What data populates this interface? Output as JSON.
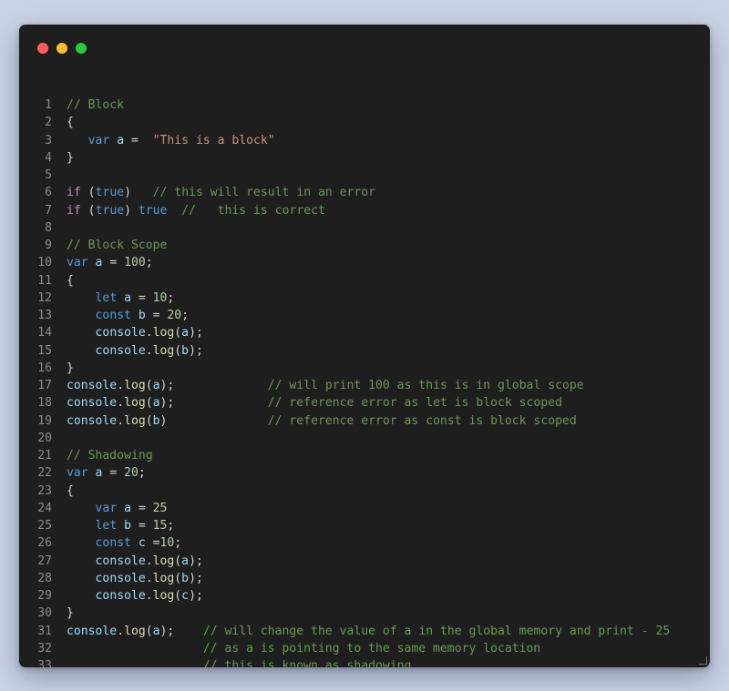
{
  "window": {
    "controls": {
      "close_color": "#ff5f57",
      "minimize_color": "#febc2e",
      "zoom_color": "#28c840"
    }
  },
  "code": {
    "lines": [
      {
        "n": "1",
        "tokens": [
          [
            "c",
            "// Block"
          ]
        ]
      },
      {
        "n": "2",
        "tokens": [
          [
            "p",
            "{"
          ]
        ]
      },
      {
        "n": "3",
        "tokens": [
          [
            "p",
            "   "
          ],
          [
            "k",
            "var"
          ],
          [
            "p",
            " "
          ],
          [
            "v",
            "a"
          ],
          [
            "p",
            " =  "
          ],
          [
            "s",
            "\"This is a block\""
          ]
        ]
      },
      {
        "n": "4",
        "tokens": [
          [
            "p",
            "}"
          ]
        ]
      },
      {
        "n": "5",
        "tokens": []
      },
      {
        "n": "6",
        "tokens": [
          [
            "kc",
            "if"
          ],
          [
            "p",
            " ("
          ],
          [
            "k",
            "true"
          ],
          [
            "p",
            ")   "
          ],
          [
            "c",
            "// this will result in an error"
          ]
        ]
      },
      {
        "n": "7",
        "tokens": [
          [
            "kc",
            "if"
          ],
          [
            "p",
            " ("
          ],
          [
            "k",
            "true"
          ],
          [
            "p",
            ") "
          ],
          [
            "k",
            "true"
          ],
          [
            "p",
            "  "
          ],
          [
            "c",
            "//   this is correct"
          ]
        ]
      },
      {
        "n": "8",
        "tokens": []
      },
      {
        "n": "9",
        "tokens": [
          [
            "c",
            "// Block Scope"
          ]
        ]
      },
      {
        "n": "10",
        "tokens": [
          [
            "k",
            "var"
          ],
          [
            "p",
            " "
          ],
          [
            "v",
            "a"
          ],
          [
            "p",
            " = "
          ],
          [
            "n",
            "100"
          ],
          [
            "p",
            ";"
          ]
        ]
      },
      {
        "n": "11",
        "tokens": [
          [
            "p",
            "{"
          ]
        ]
      },
      {
        "n": "12",
        "tokens": [
          [
            "p",
            "    "
          ],
          [
            "k",
            "let"
          ],
          [
            "p",
            " "
          ],
          [
            "v",
            "a"
          ],
          [
            "p",
            " = "
          ],
          [
            "n",
            "10"
          ],
          [
            "p",
            ";"
          ]
        ]
      },
      {
        "n": "13",
        "tokens": [
          [
            "p",
            "    "
          ],
          [
            "k",
            "const"
          ],
          [
            "p",
            " "
          ],
          [
            "v",
            "b"
          ],
          [
            "p",
            " = "
          ],
          [
            "n",
            "20"
          ],
          [
            "p",
            ";"
          ]
        ]
      },
      {
        "n": "14",
        "tokens": [
          [
            "p",
            "    "
          ],
          [
            "v",
            "console"
          ],
          [
            "p",
            "."
          ],
          [
            "f",
            "log"
          ],
          [
            "p",
            "("
          ],
          [
            "v",
            "a"
          ],
          [
            "p",
            ");"
          ]
        ]
      },
      {
        "n": "15",
        "tokens": [
          [
            "p",
            "    "
          ],
          [
            "v",
            "console"
          ],
          [
            "p",
            "."
          ],
          [
            "f",
            "log"
          ],
          [
            "p",
            "("
          ],
          [
            "v",
            "b"
          ],
          [
            "p",
            ");"
          ]
        ]
      },
      {
        "n": "16",
        "tokens": [
          [
            "p",
            "}"
          ]
        ]
      },
      {
        "n": "17",
        "tokens": [
          [
            "v",
            "console"
          ],
          [
            "p",
            "."
          ],
          [
            "f",
            "log"
          ],
          [
            "p",
            "("
          ],
          [
            "v",
            "a"
          ],
          [
            "p",
            ");             "
          ],
          [
            "c",
            "// will print 100 as this is in global scope"
          ]
        ]
      },
      {
        "n": "18",
        "tokens": [
          [
            "v",
            "console"
          ],
          [
            "p",
            "."
          ],
          [
            "f",
            "log"
          ],
          [
            "p",
            "("
          ],
          [
            "v",
            "a"
          ],
          [
            "p",
            ");             "
          ],
          [
            "c",
            "// reference error as let is block scoped"
          ]
        ]
      },
      {
        "n": "19",
        "tokens": [
          [
            "v",
            "console"
          ],
          [
            "p",
            "."
          ],
          [
            "f",
            "log"
          ],
          [
            "p",
            "("
          ],
          [
            "v",
            "b"
          ],
          [
            "p",
            ")              "
          ],
          [
            "c",
            "// reference error as const is block scoped"
          ]
        ]
      },
      {
        "n": "20",
        "tokens": []
      },
      {
        "n": "21",
        "tokens": [
          [
            "c",
            "// Shadowing"
          ]
        ]
      },
      {
        "n": "22",
        "tokens": [
          [
            "k",
            "var"
          ],
          [
            "p",
            " "
          ],
          [
            "v",
            "a"
          ],
          [
            "p",
            " = "
          ],
          [
            "n",
            "20"
          ],
          [
            "p",
            ";"
          ]
        ]
      },
      {
        "n": "23",
        "tokens": [
          [
            "p",
            "{"
          ]
        ]
      },
      {
        "n": "24",
        "tokens": [
          [
            "p",
            "    "
          ],
          [
            "k",
            "var"
          ],
          [
            "p",
            " "
          ],
          [
            "v",
            "a"
          ],
          [
            "p",
            " = "
          ],
          [
            "n",
            "25"
          ]
        ]
      },
      {
        "n": "25",
        "tokens": [
          [
            "p",
            "    "
          ],
          [
            "k",
            "let"
          ],
          [
            "p",
            " "
          ],
          [
            "v",
            "b"
          ],
          [
            "p",
            " = "
          ],
          [
            "n",
            "15"
          ],
          [
            "p",
            ";"
          ]
        ]
      },
      {
        "n": "26",
        "tokens": [
          [
            "p",
            "    "
          ],
          [
            "k",
            "const"
          ],
          [
            "p",
            " "
          ],
          [
            "v",
            "c"
          ],
          [
            "p",
            " ="
          ],
          [
            "n",
            "10"
          ],
          [
            "p",
            ";"
          ]
        ]
      },
      {
        "n": "27",
        "tokens": [
          [
            "p",
            "    "
          ],
          [
            "v",
            "console"
          ],
          [
            "p",
            "."
          ],
          [
            "f",
            "log"
          ],
          [
            "p",
            "("
          ],
          [
            "v",
            "a"
          ],
          [
            "p",
            ");"
          ]
        ]
      },
      {
        "n": "28",
        "tokens": [
          [
            "p",
            "    "
          ],
          [
            "v",
            "console"
          ],
          [
            "p",
            "."
          ],
          [
            "f",
            "log"
          ],
          [
            "p",
            "("
          ],
          [
            "v",
            "b"
          ],
          [
            "p",
            ");"
          ]
        ]
      },
      {
        "n": "29",
        "tokens": [
          [
            "p",
            "    "
          ],
          [
            "v",
            "console"
          ],
          [
            "p",
            "."
          ],
          [
            "f",
            "log"
          ],
          [
            "p",
            "("
          ],
          [
            "v",
            "c"
          ],
          [
            "p",
            ");"
          ]
        ]
      },
      {
        "n": "30",
        "tokens": [
          [
            "p",
            "}"
          ]
        ]
      },
      {
        "n": "31",
        "tokens": [
          [
            "v",
            "console"
          ],
          [
            "p",
            "."
          ],
          [
            "f",
            "log"
          ],
          [
            "p",
            "("
          ],
          [
            "v",
            "a"
          ],
          [
            "p",
            ");    "
          ],
          [
            "c",
            "// will change the value of a in the global memory and print - 25"
          ]
        ]
      },
      {
        "n": "32",
        "tokens": [
          [
            "p",
            "                   "
          ],
          [
            "c",
            "// as a is pointing to the same memory location"
          ]
        ]
      },
      {
        "n": "33",
        "tokens": [
          [
            "p",
            "                   "
          ],
          [
            "c",
            "// this is known as shadowing."
          ]
        ]
      }
    ]
  }
}
